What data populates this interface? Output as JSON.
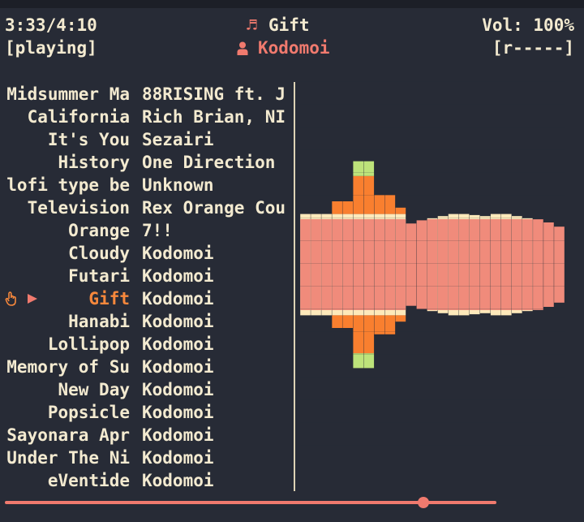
{
  "player": {
    "elapsed_total": "3:33/4:10",
    "state": "[playing]",
    "song_icon": "♬",
    "song_title": "Gift",
    "artist_icon": "person-icon",
    "artist": "Kodomoi",
    "volume": "Vol: 100%",
    "repeat_shuffle": "[r-----]",
    "progress_fraction": 0.852
  },
  "playlist": {
    "current_index": 9,
    "rows": [
      {
        "title": "Midsummer Ma",
        "artist": "88RISING ft. J"
      },
      {
        "title": "California",
        "artist": "Rich Brian, NI"
      },
      {
        "title": "It's You",
        "artist": "Sezairi"
      },
      {
        "title": "History",
        "artist": "One Direction"
      },
      {
        "title": "lofi type be",
        "artist": "Unknown"
      },
      {
        "title": "Television",
        "artist": "Rex Orange Cou"
      },
      {
        "title": "Orange",
        "artist": "7!!"
      },
      {
        "title": "Cloudy",
        "artist": "Kodomoi"
      },
      {
        "title": "Futari",
        "artist": "Kodomoi"
      },
      {
        "title": "Gift",
        "artist": "Kodomoi"
      },
      {
        "title": "Hanabi",
        "artist": "Kodomoi"
      },
      {
        "title": "Lollipop",
        "artist": "Kodomoi"
      },
      {
        "title": "Memory of Su",
        "artist": "Kodomoi"
      },
      {
        "title": "New Day",
        "artist": "Kodomoi"
      },
      {
        "title": "Popsicle",
        "artist": "Kodomoi"
      },
      {
        "title": "Sayonara Apr",
        "artist": "Kodomoi"
      },
      {
        "title": "Under The Ni",
        "artist": "Kodomoi"
      },
      {
        "title": "eVentide",
        "artist": "Kodomoi"
      }
    ]
  },
  "visualizer": {
    "colors": {
      "base": "#fde9bb",
      "band": "#f08b7b",
      "mid": "#f97f2f",
      "peak": "#bde37a"
    },
    "levels": [
      0.48,
      0.48,
      0.48,
      0.6,
      0.6,
      0.98,
      0.98,
      0.66,
      0.66,
      0.54,
      0.39,
      0.42,
      0.44,
      0.46,
      0.48,
      0.48,
      0.47,
      0.46,
      0.48,
      0.48,
      0.46,
      0.44,
      0.43,
      0.4,
      0.36
    ]
  }
}
